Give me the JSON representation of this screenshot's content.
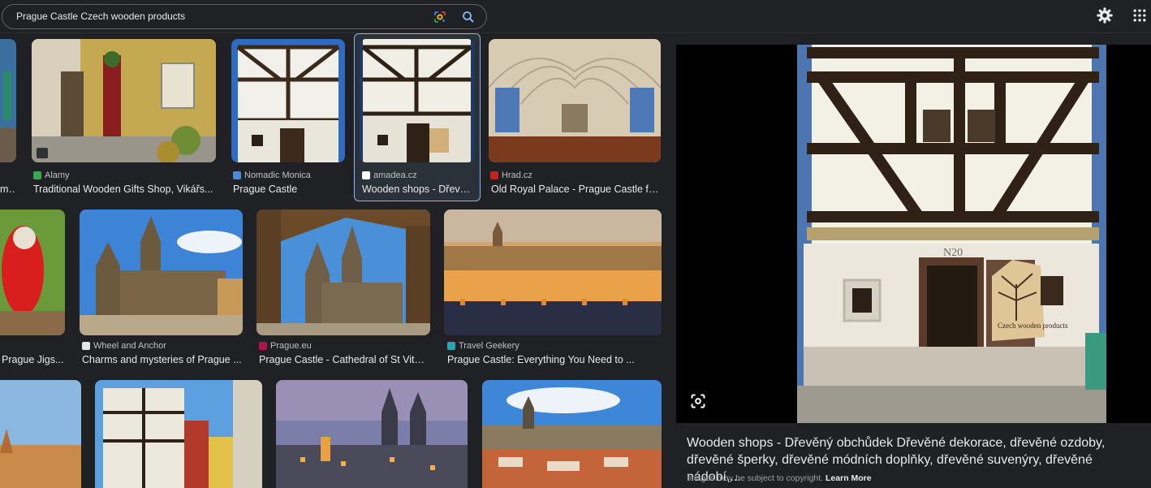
{
  "search": {
    "query": "Prague Castle Czech wooden products"
  },
  "row1": [
    {
      "source": "",
      "title": "m..."
    },
    {
      "source": "Alamy",
      "title": "Traditional Wooden Gifts Shop, Vikářs...",
      "fav": "#34a853"
    },
    {
      "source": "Nomadic Monica",
      "title": "Prague Castle",
      "fav": "#4f8ad1"
    },
    {
      "source": "amadea.cz",
      "title": "Wooden shops - Dřevě...",
      "fav": "#ffffff"
    },
    {
      "source": "Hrad.cz",
      "title": "Old Royal Palace - Prague Castle fo...",
      "fav": "#c5221f"
    }
  ],
  "row2": [
    {
      "source": "",
      "title": "Prague Jigs..."
    },
    {
      "source": "Wheel and Anchor",
      "title": "Charms and mysteries of Prague ...",
      "fav": "#e6e6e6"
    },
    {
      "source": "Prague.eu",
      "title": "Prague Castle - Cathedral of St Vitu...",
      "fav": "#b3124e"
    },
    {
      "source": "Travel Geekery",
      "title": "Prague Castle: Everything You Need to ...",
      "fav": "#2aa6b3"
    }
  ],
  "panel": {
    "description": "Wooden shops - Dřevěný obchůdek Dřevěné dekorace, dřevěné ozdoby, dřevěné šperky, dřevěné módních doplňky, dřevěné suvenýry, dřevěné nádobí,...",
    "copyright": "Images may be subject to copyright.",
    "learn_more": "Learn More",
    "sign_text": "Czech wooden products",
    "house_number": "N20"
  },
  "icons": [
    "google-lens-icon",
    "search-icon",
    "settings-gear-icon",
    "apps-grid-icon",
    "lens-search-icon"
  ]
}
